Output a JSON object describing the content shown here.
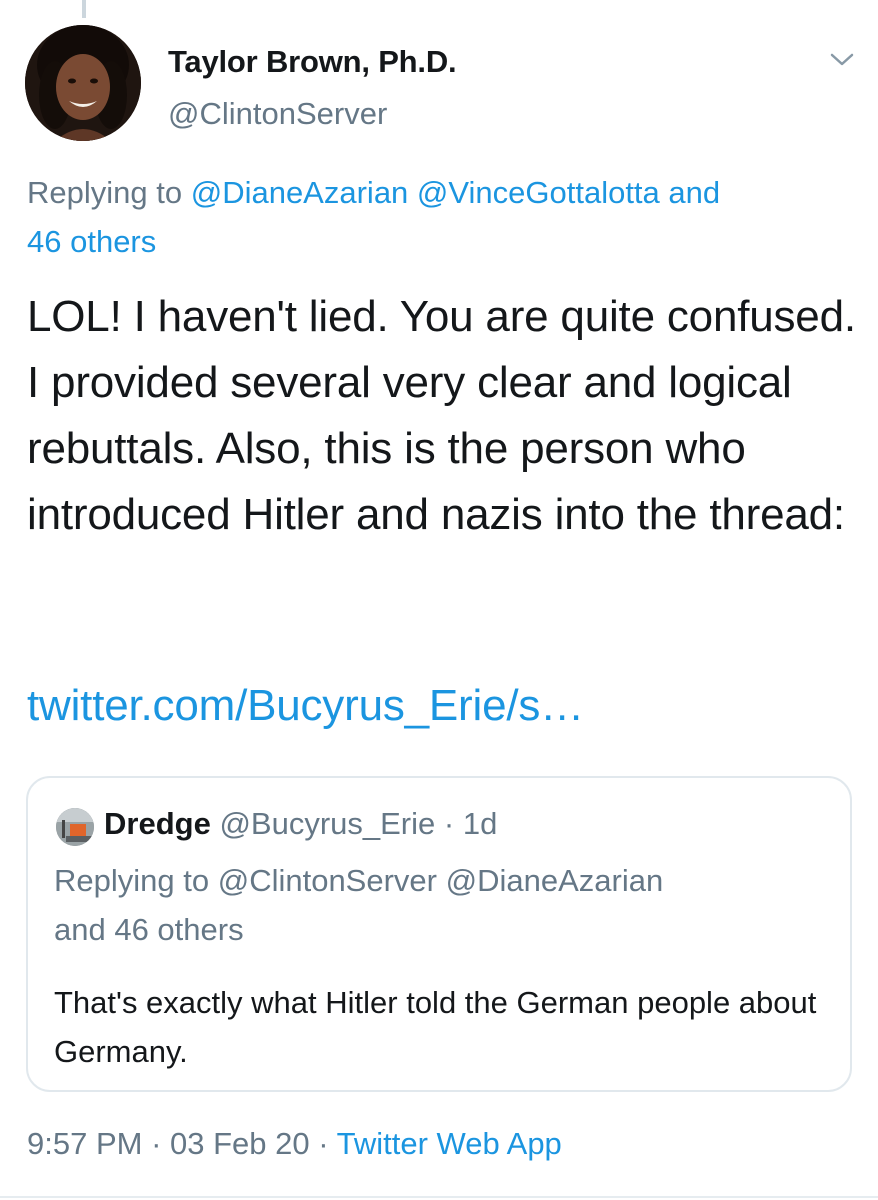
{
  "tweet": {
    "author": {
      "display_name": "Taylor Brown, Ph.D.",
      "handle": "@ClintonServer",
      "avatar_icon": "profile-photo"
    },
    "menu_icon": "chevron-down-icon",
    "replying_to": {
      "prefix": "Replying to",
      "mentions": [
        "@DianeAzarian",
        "@VinceGottalotta"
      ],
      "and_text": "and",
      "others": "46 others"
    },
    "text": "LOL! I haven't lied. You are quite confused.  I provided several very clear and logical rebuttals.  Also, this is the person who introduced Hitler and nazis into the thread:",
    "link": "twitter.com/Bucyrus_Erie/s…",
    "quoted": {
      "name": "Dredge",
      "handle": "@Bucyrus_Erie",
      "separator": "·",
      "time": "1d",
      "replying_to": {
        "prefix": "Replying to",
        "mentions": [
          "@ClintonServer",
          "@DianeAzarian"
        ],
        "suffix": "and 46 others"
      },
      "text": "That's exactly what Hitler told the German people about Germany."
    },
    "meta": {
      "time": "9:57 PM",
      "sep1": "·",
      "date": "03 Feb 20",
      "sep2": "·",
      "source": "Twitter Web App"
    }
  },
  "colors": {
    "link": "#1b95e0",
    "secondary_text": "#657786",
    "primary_text": "#14171a",
    "border": "#e1e8ed"
  }
}
